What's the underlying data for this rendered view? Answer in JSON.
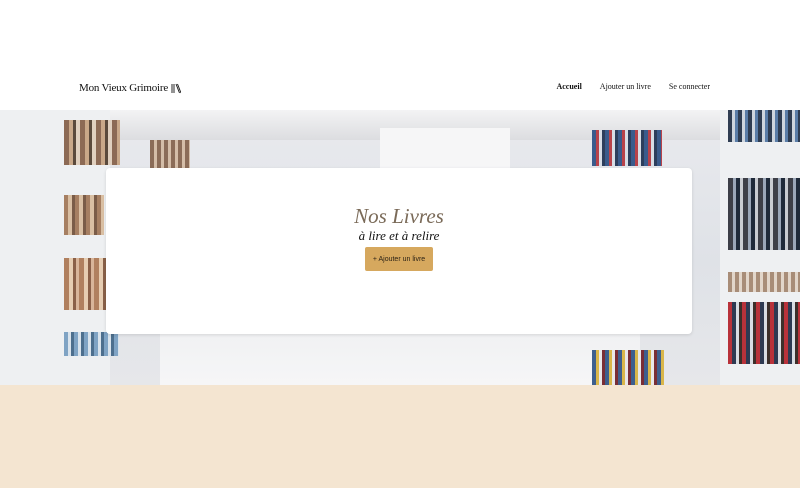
{
  "header": {
    "logo_text": "Mon Vieux Grimoire",
    "logo_icon": "books-icon",
    "nav": [
      {
        "label": "Accueil",
        "active": true
      },
      {
        "label": "Ajouter un livre",
        "active": false
      },
      {
        "label": "Se connecter",
        "active": false
      }
    ]
  },
  "hero": {
    "title": "Nos Livres",
    "subtitle": "à lire et à relire",
    "add_button_label": "+ Ajouter un livre"
  },
  "colors": {
    "accent": "#d6a85e",
    "title": "#7a6a58",
    "footer_band": "#f4e5d1"
  }
}
